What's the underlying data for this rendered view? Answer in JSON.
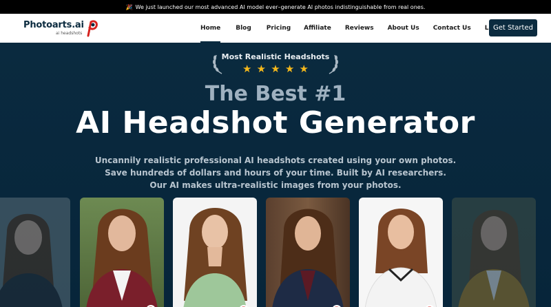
{
  "announcement": {
    "icon": "party-popper-icon",
    "text": "We just launched our most advanced AI model ever–generate AI photos indistinguishable from real ones."
  },
  "brand": {
    "name": "Photoarts.ai",
    "tagline": "ai headshots",
    "accent": "#d5231f",
    "primary": "#0b2b3f"
  },
  "nav": {
    "items": [
      {
        "label": "Home",
        "active": true
      },
      {
        "label": "Blog"
      },
      {
        "label": "Pricing"
      },
      {
        "label": "Affiliate"
      },
      {
        "label": "Reviews"
      },
      {
        "label": "About Us"
      },
      {
        "label": "Contact Us"
      },
      {
        "label": "Login"
      }
    ],
    "cta": "Get Started"
  },
  "award": {
    "title": "Most Realistic Headshots",
    "stars": 5,
    "star_color": "#f4b81c"
  },
  "hero": {
    "headline_top": "The Best #1",
    "headline_main": "AI Headshot Generator",
    "subtext": [
      "Uncannily realistic professional AI headshots created using your own photos.",
      "Save hundreds of dollars and hours of your time. Built by AI researchers.",
      "Our AI makes ultra-realistic images from your photos."
    ]
  },
  "gallery": {
    "items": [
      {
        "label": "headshot-striped-shirt",
        "bg": "#6e7f86",
        "outfit": "#2b2f36",
        "faded": true
      },
      {
        "label": "headshot-burgundy-blazer",
        "bg": "#5f7a4a",
        "outfit": "#7a1f2b",
        "faded": false
      },
      {
        "label": "headshot-green-top",
        "bg": "#f2f2f2",
        "outfit": "#9ec79a",
        "faded": false
      },
      {
        "label": "headshot-navy-blazer-library",
        "bg": "#5a3f2e",
        "outfit": "#1e2b45",
        "faded": false
      },
      {
        "label": "headshot-chef-jacket",
        "bg": "#f5f5f5",
        "outfit": "#f3f3f3",
        "faded": false
      },
      {
        "label": "headshot-mustard-blazer",
        "bg": "#4e5a4a",
        "outfit": "#b88a2a",
        "faded": true
      }
    ]
  }
}
